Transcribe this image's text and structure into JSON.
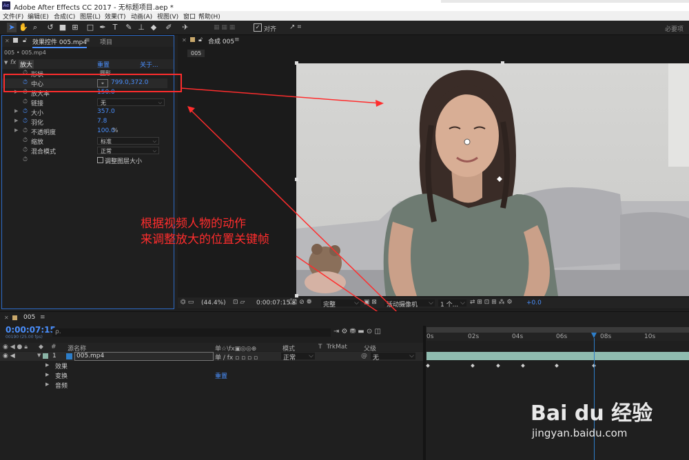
{
  "app": {
    "title": "Adobe After Effects CC 2017 - 无标题项目.aep *",
    "logo": "Ae"
  },
  "menu": [
    "文件(F)",
    "编辑(E)",
    "合成(C)",
    "图层(L)",
    "效果(T)",
    "动画(A)",
    "视图(V)",
    "窗口",
    "帮助(H)"
  ],
  "toolbar": {
    "tools": [
      "selection-tool",
      "hand-tool",
      "zoom-tool",
      "rotate-tool",
      "camera-tool",
      "pan-behind-tool",
      "rectangle-tool",
      "pen-tool",
      "type-tool",
      "brush-tool",
      "clone-stamp-tool",
      "eraser-tool",
      "roto-brush-tool",
      "puppet-tool"
    ],
    "snap_label": "对齐",
    "workspace": "必要项"
  },
  "effect_controls": {
    "tab_label": "效果控件 005.mp4",
    "project_tab": "项目",
    "breadcrumb": "005 • 005.mp4",
    "effect_name": "放大",
    "reset_label": "重置",
    "about_label": "关于...",
    "properties": [
      {
        "name": "形状",
        "value": "圆形",
        "type": "dropdown",
        "stopwatch": false
      },
      {
        "name": "中心",
        "value": "799.0,372.0",
        "type": "point",
        "stopwatch": true
      },
      {
        "name": "放大率",
        "value": "150.0",
        "type": "number",
        "stopwatch": false
      },
      {
        "name": "链接",
        "value": "无",
        "type": "dropdown",
        "stopwatch": false
      },
      {
        "name": "大小",
        "value": "357.0",
        "type": "number",
        "stopwatch": true
      },
      {
        "name": "羽化",
        "value": "7.8",
        "type": "number",
        "stopwatch": true
      },
      {
        "name": "不透明度",
        "value": "100.0",
        "unit": "%",
        "type": "number",
        "stopwatch": false
      },
      {
        "name": "缩放",
        "value": "标准",
        "type": "dropdown",
        "stopwatch": false
      },
      {
        "name": "混合模式",
        "value": "正常",
        "type": "dropdown",
        "stopwatch": false
      },
      {
        "name": "",
        "value": "调整图层大小",
        "type": "checkbox",
        "stopwatch": false
      }
    ]
  },
  "composition": {
    "tab_label": "合成 005",
    "comp_chip": "005",
    "zoom": "(44.4%)",
    "timecode": "0:00:07:15",
    "resolution": "完整",
    "camera": "活动摄像机",
    "views": "1 个...",
    "exposure": "+0.0"
  },
  "annotation": {
    "line1": "根据视频人物的动作",
    "line2": "来调整放大的位置关键帧",
    "color": "#ff2d2d"
  },
  "timeline": {
    "tab_label": "005",
    "current_time": "0:00:07:15",
    "frame_info": "00190 (25.00 fps)",
    "search_placeholder": "ρ.",
    "columns": {
      "num": "#",
      "source": "源名称",
      "switches": "单☆\\fx▣◎◎⊕",
      "mode": "模式",
      "t": "T",
      "trkmat": "TrkMat",
      "parent": "父级"
    },
    "layer": {
      "index": "1",
      "name": "005.mp4",
      "mode": "正常",
      "parent": "无"
    },
    "subrows": [
      "效果",
      "变换",
      "音频"
    ],
    "transform_reset": "重置",
    "ruler": [
      "0s",
      "02s",
      "04s",
      "06s",
      "08s",
      "10s"
    ],
    "keyframe_count": 6
  },
  "watermark": {
    "brand": "Bai du 经验",
    "url": "jingyan.baidu.com"
  }
}
